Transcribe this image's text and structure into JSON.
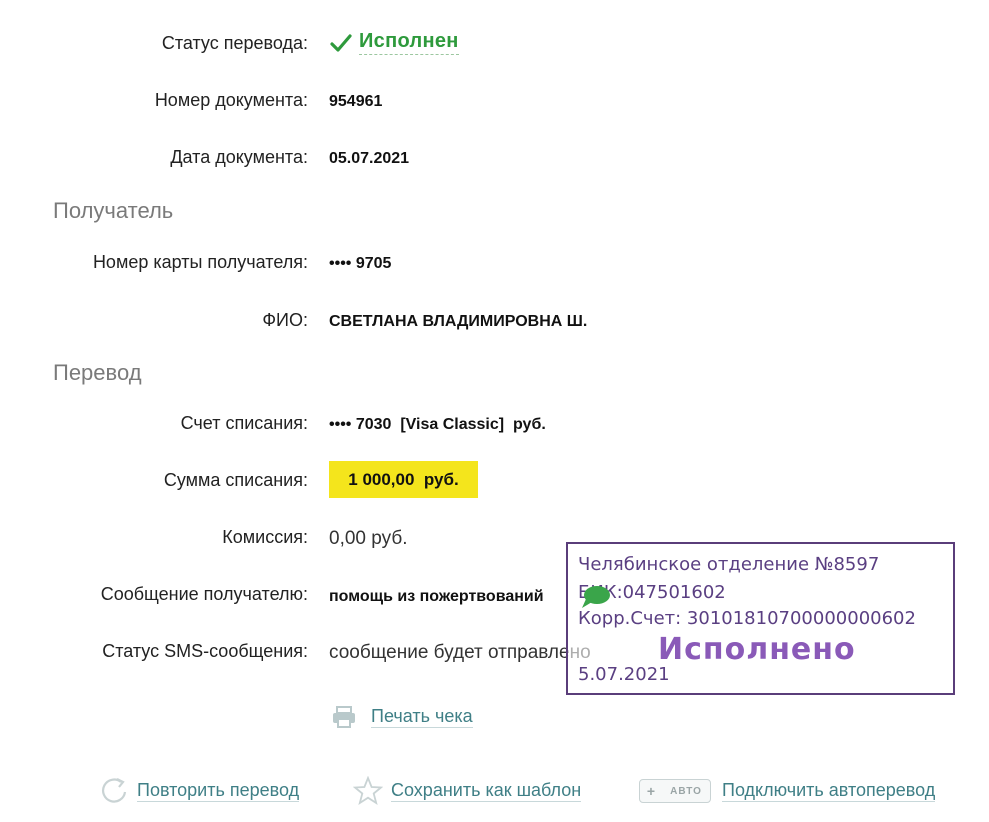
{
  "transfer": {
    "status_label": "Статус перевода:",
    "status_value": "Исполнен",
    "doc_number_label": "Номер документа:",
    "doc_number": "954961",
    "doc_date_label": "Дата документа:",
    "doc_date": "05.07.2021"
  },
  "recipient": {
    "section_title": "Получатель",
    "card_label": "Номер карты получателя:",
    "card_value": "•••• 9705",
    "name_label": "ФИО:",
    "name_value": "СВЕТЛАНА ВЛАДИМИРОВНА Ш."
  },
  "payment": {
    "section_title": "Перевод",
    "account_label": "Счет списания:",
    "account_value": "•••• 7030  [Visa Classic]  руб.",
    "amount_label": "Сумма списания:",
    "amount_value": "1 000,00  руб.",
    "fee_label": "Комиссия:",
    "fee_value": "0,00 руб.",
    "message_label": "Сообщение получателю:",
    "message_value": "помощь из пожертвований",
    "sms_label": "Статус SMS-сообщения:",
    "sms_value": "сообщение будет отправлено"
  },
  "print": {
    "label": "Печать чека",
    "icon": "printer-icon"
  },
  "actions": {
    "repeat": "Повторить перевод",
    "save_template": "Сохранить как шаблон",
    "auto_badge": "АВТО",
    "auto_plus": "+",
    "connect_auto": "Подключить автоперевод"
  },
  "stamp": {
    "line1": "Челябинское отделение №8597",
    "line2": "БИК:047501602",
    "line3": "Корр.Счет: 30101810700000000602",
    "big": "Исполнено",
    "date": "5.07.2021"
  },
  "colors": {
    "success": "#2e9a3c",
    "highlight": "#f4e51c",
    "link": "#3f7f86",
    "stamp": "#5a3f82"
  }
}
